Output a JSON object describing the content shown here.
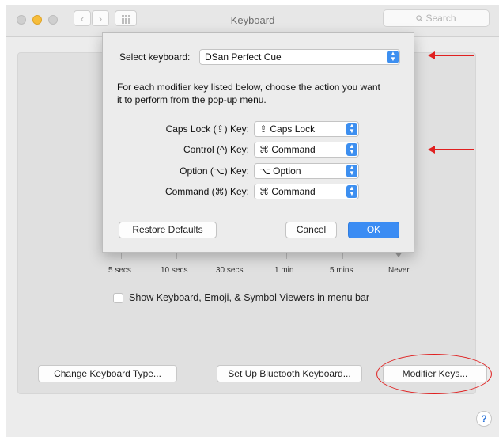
{
  "window": {
    "title": "Keyboard",
    "search_placeholder": "Search",
    "back_glyph": "‹",
    "forward_glyph": "›"
  },
  "slider_labels": [
    "5 secs",
    "10 secs",
    "30 secs",
    "1 min",
    "5 mins",
    "Never"
  ],
  "checkbox": {
    "label": "Show Keyboard, Emoji, & Symbol Viewers in menu bar",
    "checked": false
  },
  "bottom_buttons": {
    "change_type": "Change Keyboard Type...",
    "bluetooth": "Set Up Bluetooth Keyboard...",
    "modifier": "Modifier Keys..."
  },
  "help_label": "?",
  "sheet": {
    "select_label": "Select keyboard:",
    "select_value": "DSan Perfect Cue",
    "description": "For each modifier key listed below, choose the action you want it to perform from the pop-up menu.",
    "rows": [
      {
        "key": "Caps Lock (⇪) Key:",
        "value": "⇪ Caps Lock"
      },
      {
        "key": "Control (^) Key:",
        "value": "⌘ Command"
      },
      {
        "key": "Option (⌥) Key:",
        "value": "⌥ Option"
      },
      {
        "key": "Command (⌘) Key:",
        "value": "⌘ Command"
      }
    ],
    "restore_label": "Restore Defaults",
    "cancel_label": "Cancel",
    "ok_label": "OK"
  },
  "colors": {
    "accent": "#3b8cf3",
    "annotation": "#e02020"
  }
}
